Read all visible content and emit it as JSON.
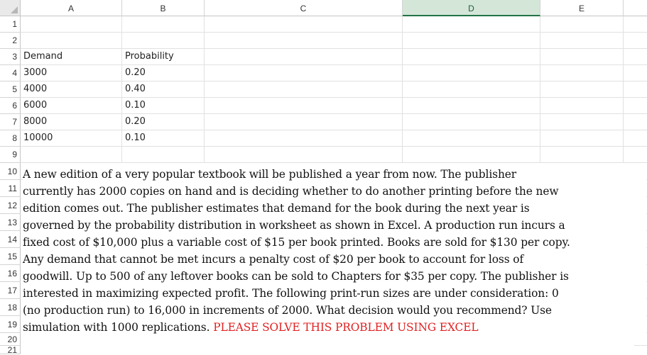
{
  "columns": [
    "A",
    "B",
    "C",
    "D",
    "E"
  ],
  "selected_column": "D",
  "rows": [
    "1",
    "2",
    "3",
    "4",
    "5",
    "6",
    "7",
    "8",
    "9",
    "10",
    "11",
    "12",
    "13",
    "14",
    "15",
    "16",
    "17",
    "18",
    "19",
    "20",
    "21"
  ],
  "table": {
    "headers": [
      "Demand",
      "Probability"
    ],
    "rows": [
      [
        "3000",
        "0.20"
      ],
      [
        "4000",
        "0.40"
      ],
      [
        "6000",
        "0.10"
      ],
      [
        "8000",
        "0.20"
      ],
      [
        "10000",
        "0.10"
      ]
    ]
  },
  "problem": {
    "lines": [
      "A new edition of a very popular textbook will be published a year from now. The publisher",
      "currently has 2000 copies on hand and is deciding whether to do another printing before the new",
      "edition comes out. The publisher estimates that demand for the book during the next year is",
      "governed by the probability distribution in worksheet as shown in Excel. A production run incurs a",
      "fixed cost of $10,000 plus a variable cost of $15 per book printed. Books are sold for $130 per copy.",
      "Any demand that cannot be met incurs a penalty cost of $20 per book to account for loss of",
      "goodwill. Up to 500 of any leftover books can be sold to Chapters for $35 per copy. The publisher is",
      "interested in maximizing expected profit. The following print-run sizes are under consideration: 0",
      "(no production run) to 16,000 in increments of 2000. What decision would you recommend? Use"
    ],
    "last_line_black": "simulation with 1000 replications. ",
    "last_line_red": "PLEASE SOLVE THIS PROBLEM USING EXCEL"
  },
  "colors": {
    "selected_header_fill": "#d3e6d8",
    "selected_header_border": "#217346",
    "highlight_text": "#e02020"
  }
}
